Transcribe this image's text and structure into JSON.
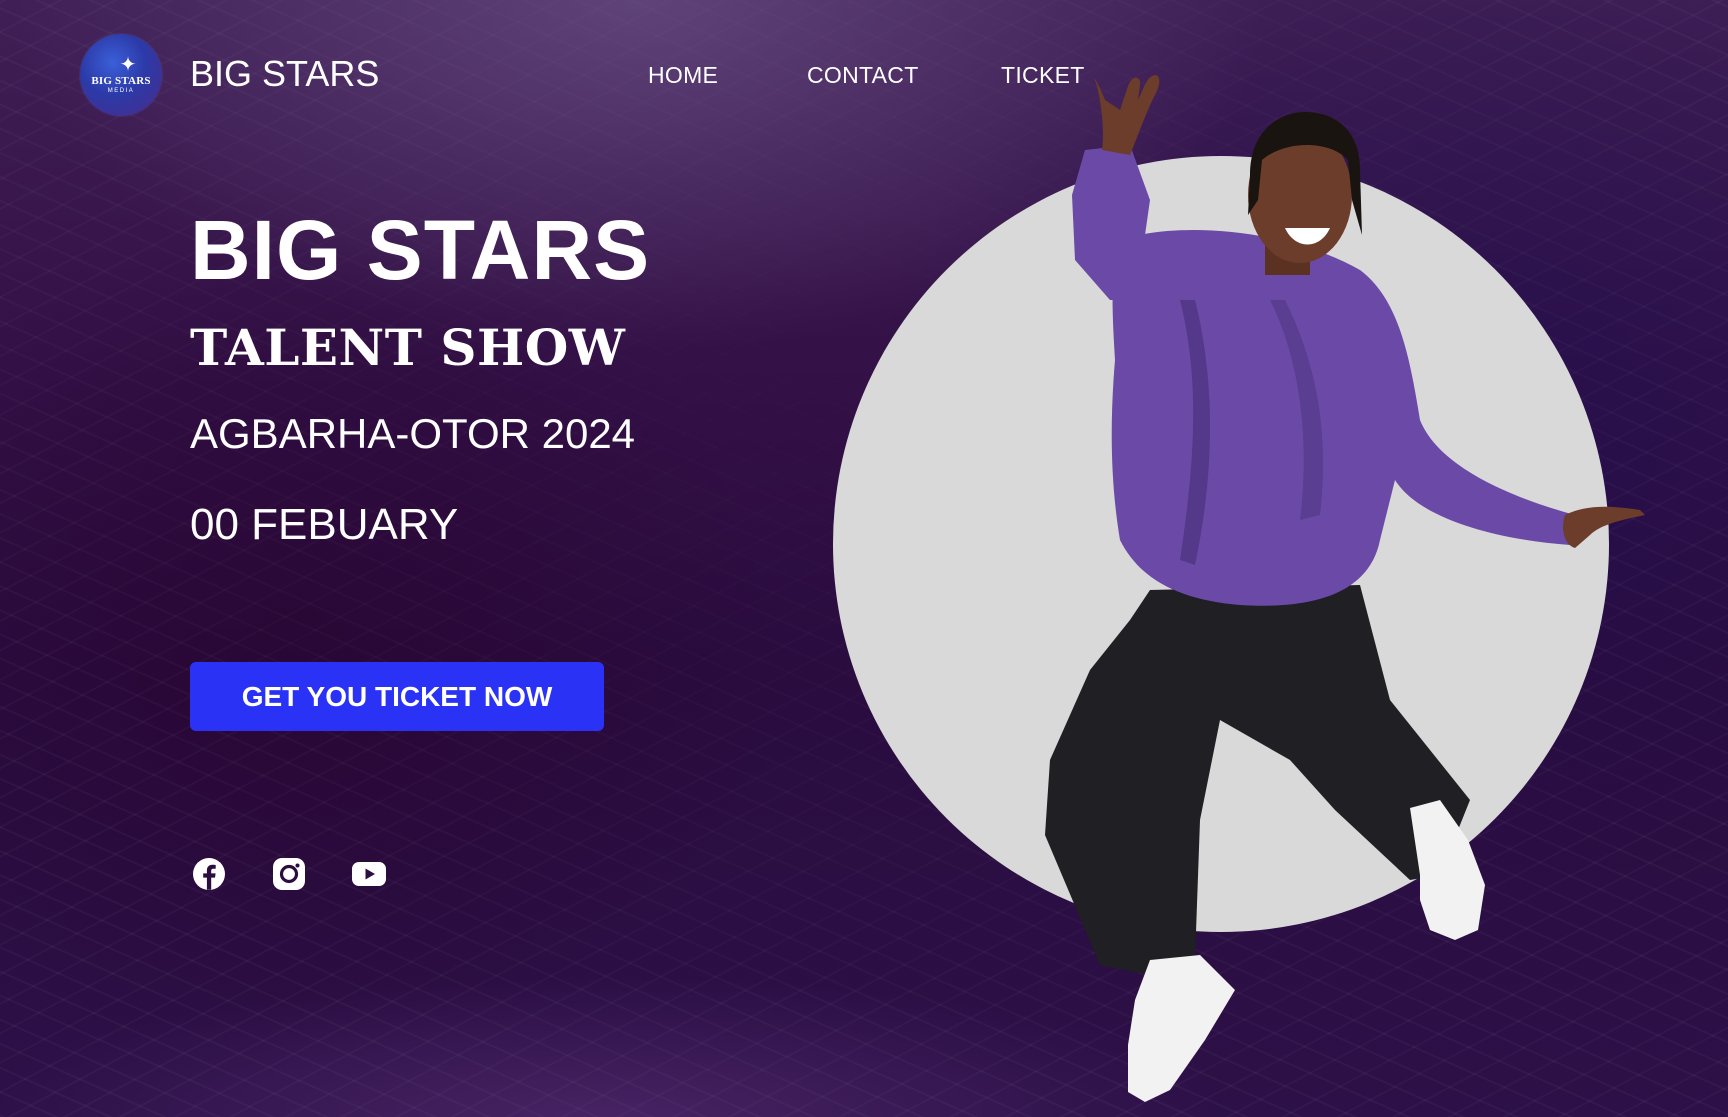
{
  "header": {
    "logo": {
      "star": "✦",
      "line1": "BIG STARS",
      "line2": "MEDIA"
    },
    "brand": "BIG STARS",
    "nav": {
      "home": "HOME",
      "contact": "CONTACT",
      "ticket": "TICKET"
    }
  },
  "hero": {
    "title": "BIG STARS",
    "subtitle": "TALENT SHOW",
    "location": "AGBARHA-OTOR 2024",
    "date": "00 FEBUARY",
    "cta": "GET YOU TICKET NOW"
  },
  "social": {
    "icons": [
      "facebook-icon",
      "instagram-icon",
      "youtube-icon"
    ]
  },
  "colors": {
    "accent": "#2a32f5",
    "circle": "#d9d9d9",
    "jacket": "#6a4aa6",
    "background": "#2a0c3f"
  }
}
